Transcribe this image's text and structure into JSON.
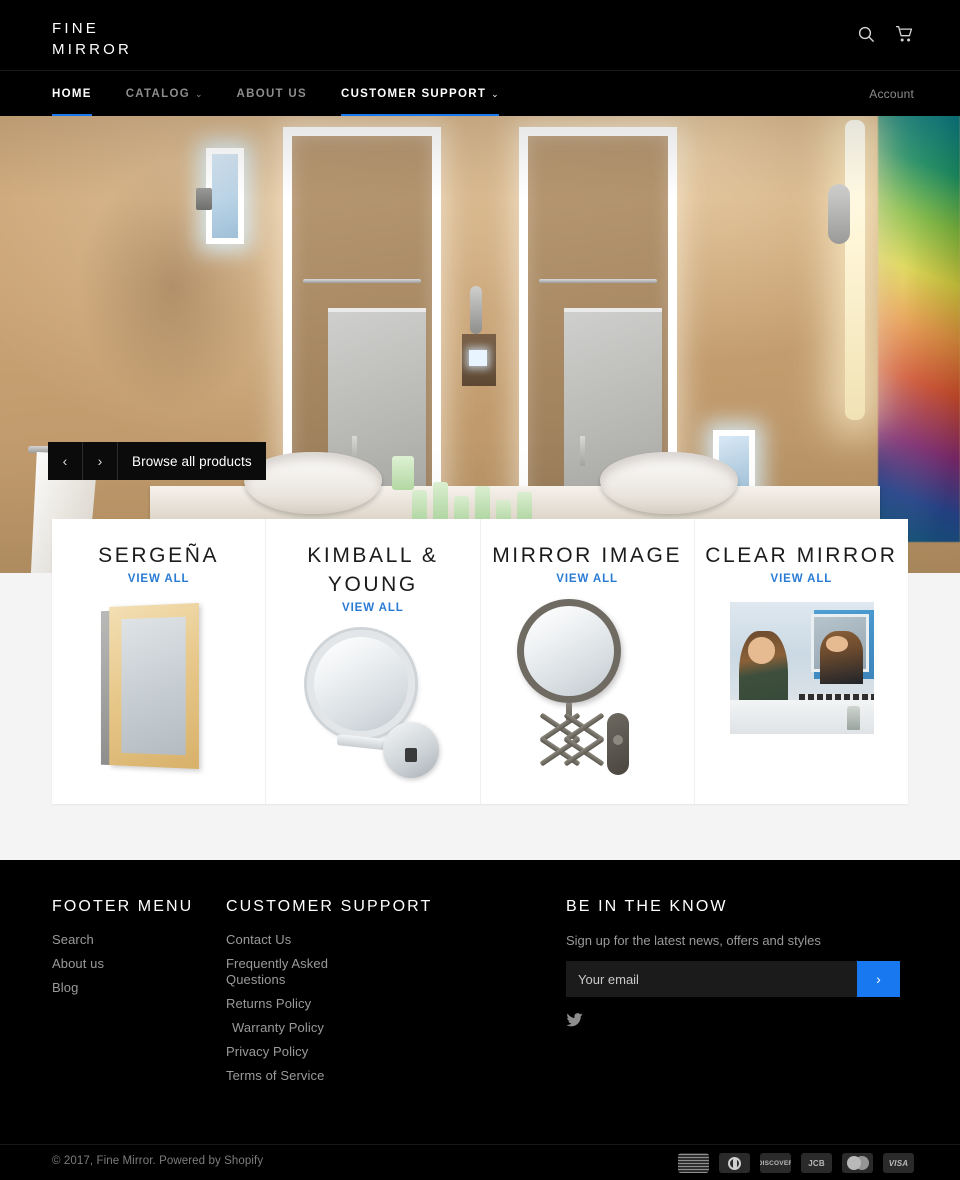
{
  "header": {
    "logo_line1": "FINE",
    "logo_line2": "MIRROR",
    "search_icon": "search-icon",
    "cart_icon": "cart-icon"
  },
  "nav": {
    "items": [
      {
        "label": "HOME",
        "has_chevron": false,
        "active": true
      },
      {
        "label": "CATALOG",
        "has_chevron": true,
        "active": false
      },
      {
        "label": "ABOUT US",
        "has_chevron": false,
        "active": false
      },
      {
        "label": "CUSTOMER SUPPORT",
        "has_chevron": true,
        "active": true
      }
    ],
    "account_label": "Account",
    "chevron_glyph": "⌄",
    "active_underline_color": "#1878f0"
  },
  "hero": {
    "prev_label": "‹",
    "next_label": "›",
    "browse_label": "Browse all products"
  },
  "collections": {
    "view_all_label": "VIEW ALL",
    "view_all_color": "#2a7bd4",
    "items": [
      {
        "title": "SERGEÑA",
        "view_all": "VIEW ALL"
      },
      {
        "title": "KIMBALL & YOUNG",
        "view_all": "VIEW ALL"
      },
      {
        "title": "MIRROR IMAGE",
        "view_all": "VIEW ALL"
      },
      {
        "title": "CLEAR MIRROR",
        "view_all": "VIEW ALL"
      }
    ]
  },
  "footer": {
    "menu": {
      "heading": "FOOTER MENU",
      "links": [
        "Search",
        "About us",
        "Blog"
      ]
    },
    "support": {
      "heading": "CUSTOMER SUPPORT",
      "links": [
        "Contact Us",
        "Frequently Asked Questions",
        "Returns Policy",
        "Warranty Policy",
        "Privacy Policy",
        "Terms of Service"
      ]
    },
    "newsletter": {
      "heading": "BE IN THE KNOW",
      "subtitle": "Sign up for the latest news, offers and styles",
      "placeholder": "Your email",
      "value": "",
      "submit_label": "›",
      "submit_color": "#1878f0"
    },
    "social": [
      {
        "name": "twitter-icon"
      }
    ],
    "copyright": "© 2017, Fine Mirror. Powered by Shopify",
    "payment_icons": [
      {
        "name": "american-express",
        "label": "AMEX"
      },
      {
        "name": "diners-club",
        "label": ""
      },
      {
        "name": "discover",
        "label": "DISCOVER"
      },
      {
        "name": "jcb",
        "label": "JCB"
      },
      {
        "name": "mastercard",
        "label": ""
      },
      {
        "name": "visa",
        "label": "VISA"
      }
    ]
  }
}
